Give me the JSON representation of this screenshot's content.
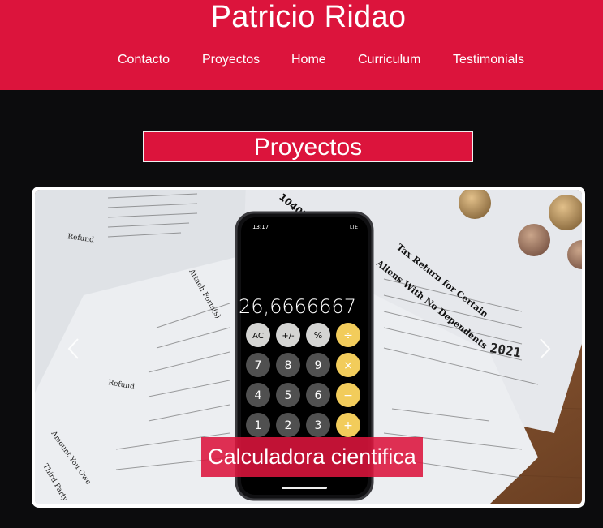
{
  "header": {
    "title": "Patricio Ridao",
    "nav": [
      {
        "label": "Contacto"
      },
      {
        "label": "Proyectos"
      },
      {
        "label": "Home"
      },
      {
        "label": "Curriculum"
      },
      {
        "label": "Testimonials"
      }
    ],
    "color": "#dc143c"
  },
  "section": {
    "title": "Proyectos"
  },
  "carousel": {
    "active_caption": "Calculadora cientifica",
    "prev_icon": "chevron-left-icon",
    "next_icon": "chevron-right-icon",
    "phone": {
      "time": "13:17",
      "display": "26,6666667",
      "keys": [
        [
          "AC",
          "+/-",
          "%",
          "÷"
        ],
        [
          "7",
          "8",
          "9",
          "×"
        ],
        [
          "4",
          "5",
          "6",
          "−"
        ],
        [
          "1",
          "2",
          "3",
          "+"
        ]
      ]
    },
    "document": {
      "form": "1040NR-EZ",
      "year": "2021",
      "heading": "Tax Return for Certain Nonresident Aliens With No Dependents"
    }
  }
}
